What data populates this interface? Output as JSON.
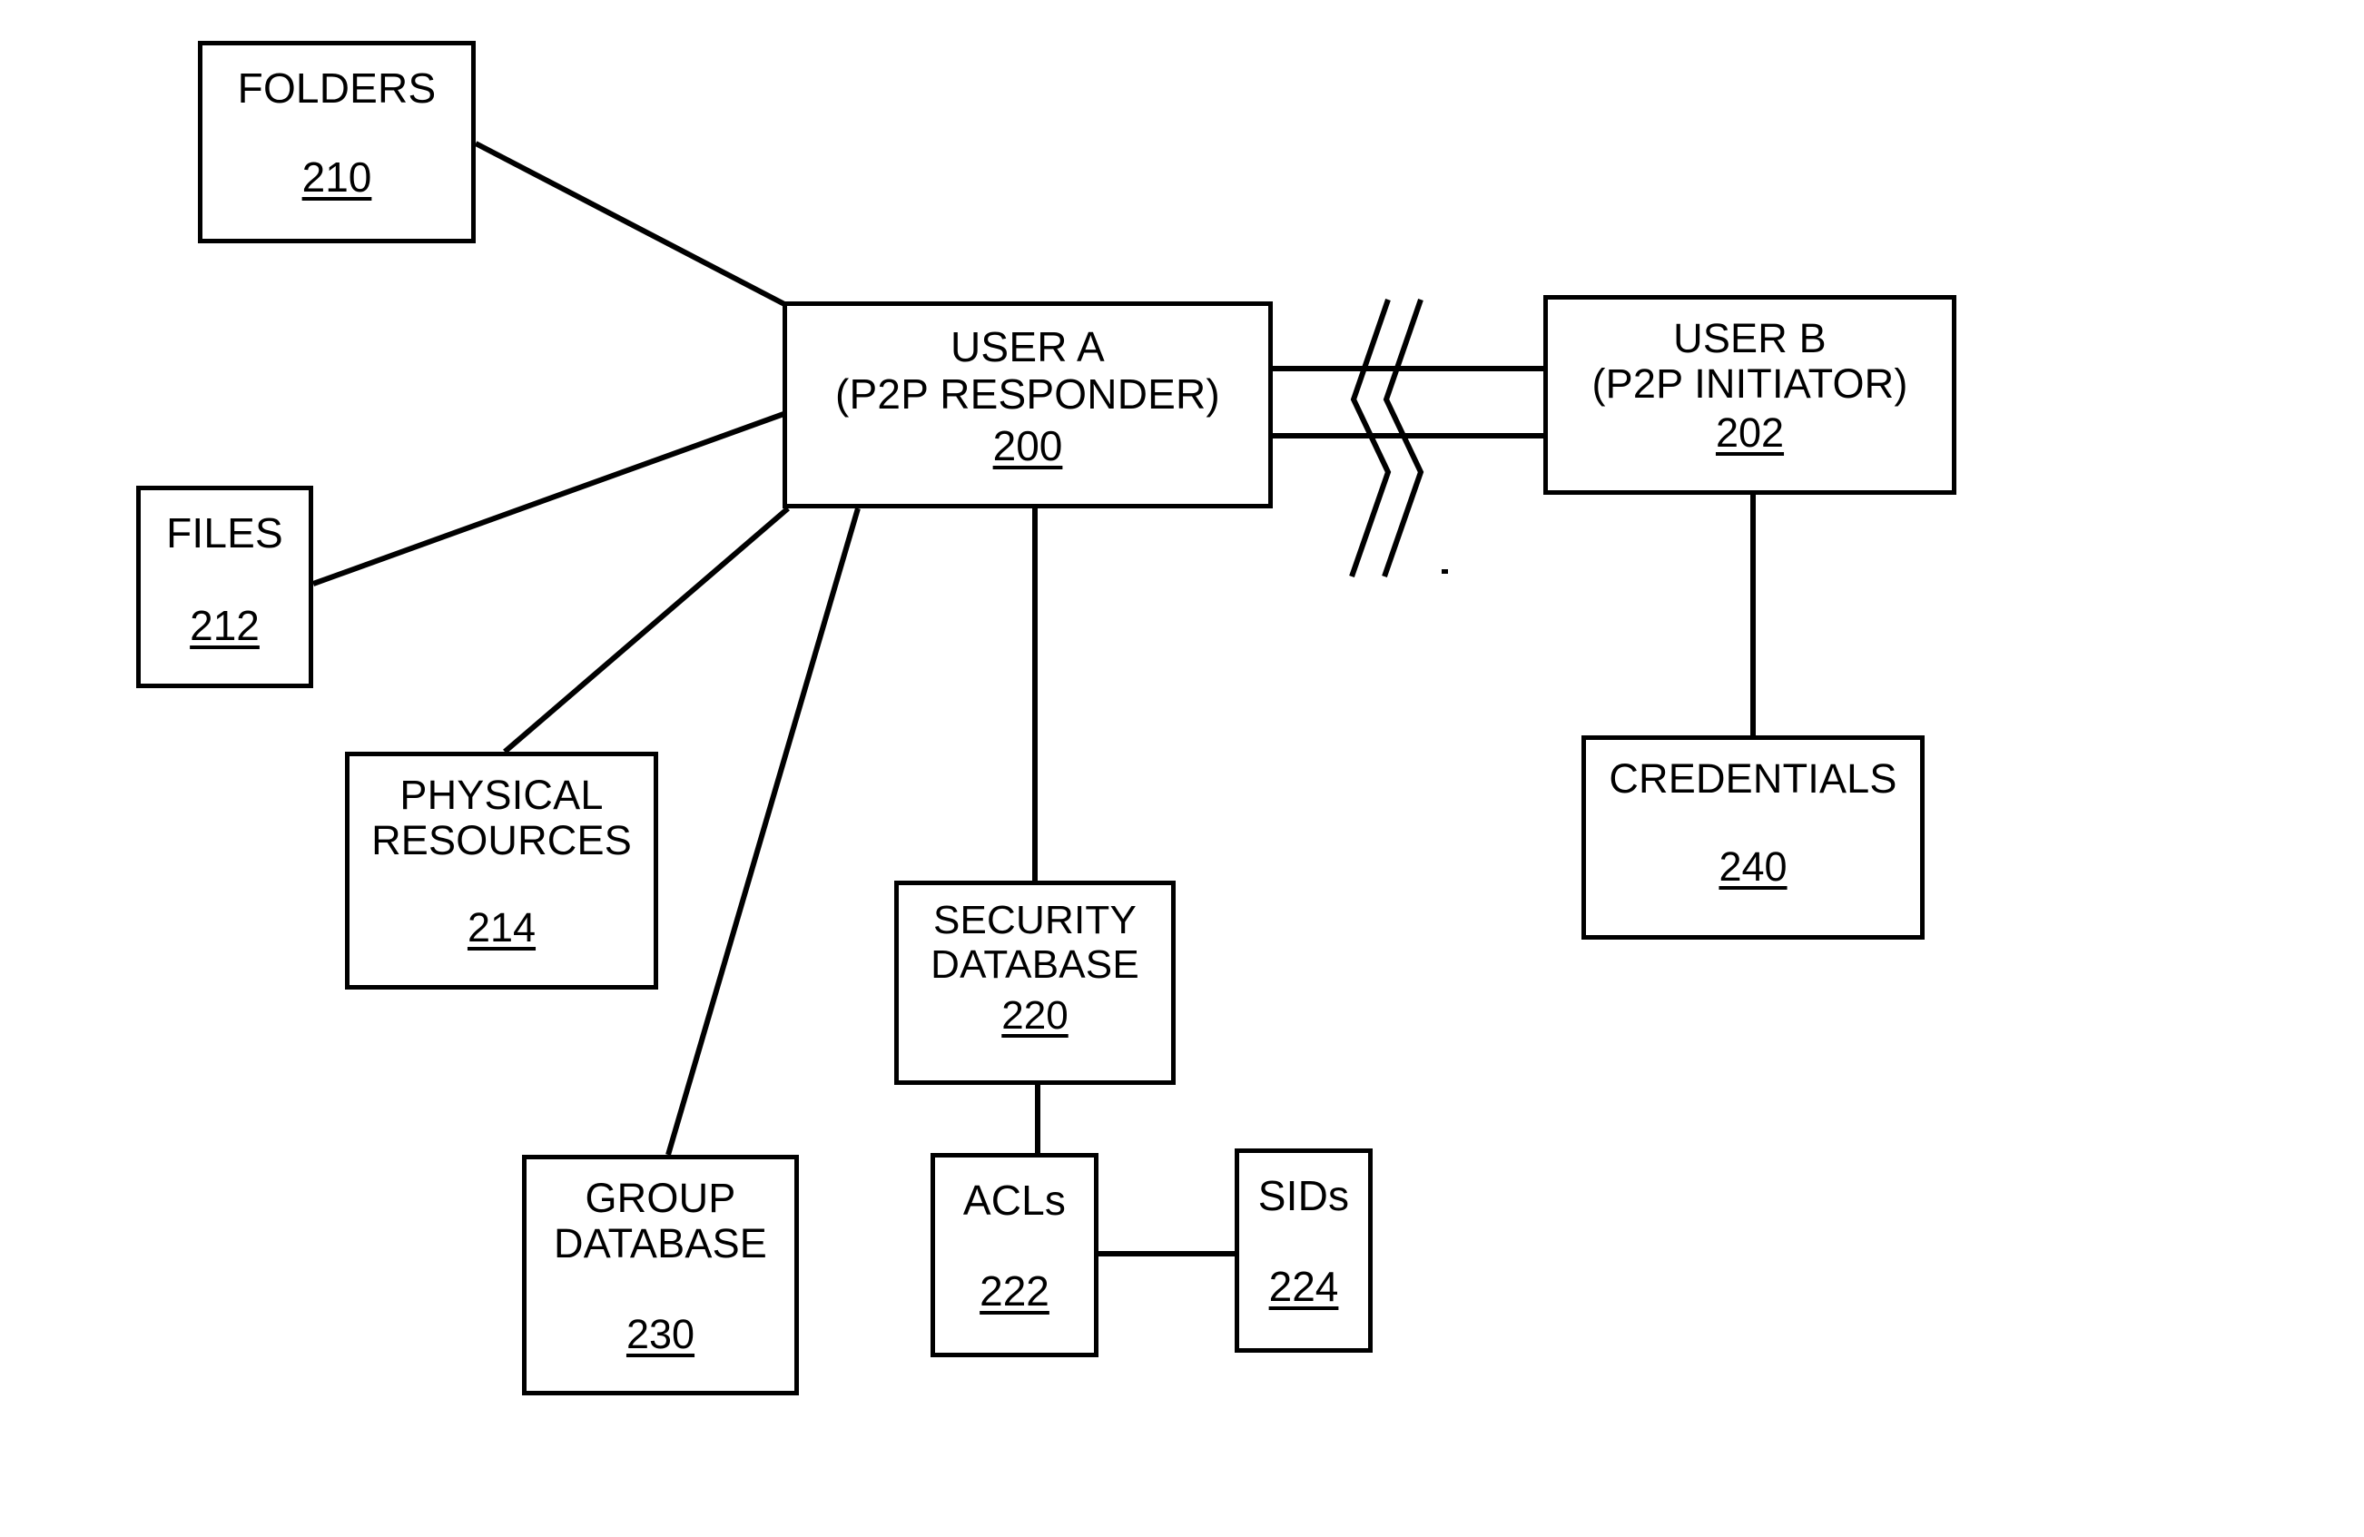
{
  "figure": {
    "kind": "patent-block-diagram",
    "background_color": "#ffffff",
    "line_color": "#000000",
    "nodes": {
      "folders": {
        "title": "FOLDERS",
        "ref": "210"
      },
      "files": {
        "title": "FILES",
        "ref": "212"
      },
      "physical_resources": {
        "title": "PHYSICAL\nRESOURCES",
        "ref": "214"
      },
      "group_database": {
        "title": "GROUP\nDATABASE",
        "ref": "230"
      },
      "security_database": {
        "title": "SECURITY\nDATABASE",
        "ref": "220"
      },
      "acls": {
        "title": "ACLs",
        "ref": "222"
      },
      "sids": {
        "title": "SIDs",
        "ref": "224"
      },
      "user_a": {
        "title": "USER  A\n(P2P RESPONDER)",
        "ref": "200"
      },
      "user_b": {
        "title": "USER  B\n(P2P INITIATOR)",
        "ref": "202"
      },
      "credentials": {
        "title": "CREDENTIALS",
        "ref": "240"
      }
    },
    "connectors": [
      {
        "name": "folders-to-user-a",
        "from": "folders",
        "to": "user_a"
      },
      {
        "name": "files-to-user-a",
        "from": "files",
        "to": "user_a"
      },
      {
        "name": "physical-resources-to-user-a",
        "from": "physical_resources",
        "to": "user_a"
      },
      {
        "name": "group-database-to-user-a",
        "from": "group_database",
        "to": "user_a"
      },
      {
        "name": "security-database-to-user-a",
        "from": "security_database",
        "to": "user_a"
      },
      {
        "name": "acls-to-security-database",
        "from": "acls",
        "to": "security_database"
      },
      {
        "name": "sids-to-acls",
        "from": "sids",
        "to": "acls"
      },
      {
        "name": "user-a-to-user-b-link",
        "from": "user_a",
        "to": "user_b",
        "style": "double-line-with-break"
      },
      {
        "name": "credentials-to-user-b",
        "from": "credentials",
        "to": "user_b"
      }
    ]
  }
}
